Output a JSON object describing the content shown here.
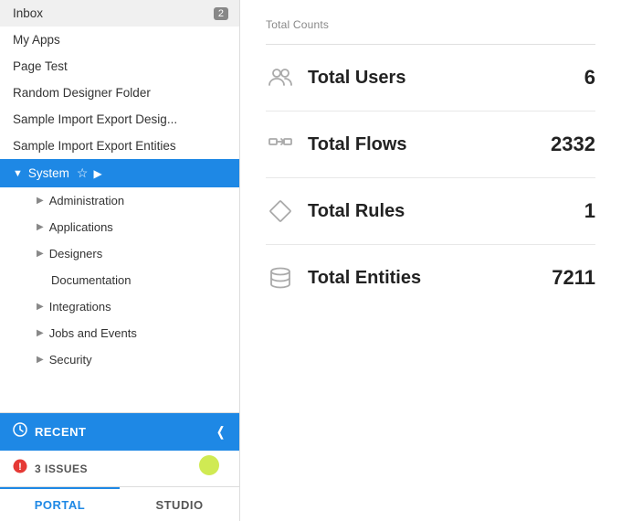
{
  "sidebar": {
    "nav_items": [
      {
        "id": "inbox",
        "label": "Inbox",
        "badge": "2",
        "indent": "root"
      },
      {
        "id": "my-apps",
        "label": "My Apps",
        "indent": "root"
      },
      {
        "id": "page-test",
        "label": "Page Test",
        "indent": "root"
      },
      {
        "id": "random-designer",
        "label": "Random Designer Folder",
        "indent": "root"
      },
      {
        "id": "sample-import-desig",
        "label": "Sample Import Export Desig...",
        "indent": "root"
      },
      {
        "id": "sample-import-entities",
        "label": "Sample Import Export Entities",
        "indent": "root"
      },
      {
        "id": "system",
        "label": "System",
        "indent": "root",
        "active": true
      }
    ],
    "sub_items": [
      {
        "id": "administration",
        "label": "Administration",
        "has_arrow": true
      },
      {
        "id": "applications",
        "label": "Applications",
        "has_arrow": true
      },
      {
        "id": "designers",
        "label": "Designers",
        "has_arrow": true
      },
      {
        "id": "documentation",
        "label": "Documentation",
        "has_arrow": false
      },
      {
        "id": "integrations",
        "label": "Integrations",
        "has_arrow": true
      },
      {
        "id": "jobs-and-events",
        "label": "Jobs and Events",
        "has_arrow": true
      },
      {
        "id": "security",
        "label": "Security",
        "has_arrow": true
      }
    ],
    "recent_label": "RECENT",
    "issues_label": "3 ISSUES",
    "tabs": [
      {
        "id": "portal",
        "label": "PORTAL"
      },
      {
        "id": "studio",
        "label": "STUDIO"
      }
    ],
    "active_tab": "portal"
  },
  "main": {
    "section_label": "Total Counts",
    "stats": [
      {
        "id": "total-users",
        "label": "Total Users",
        "value": "6",
        "icon": "users"
      },
      {
        "id": "total-flows",
        "label": "Total Flows",
        "value": "2332",
        "icon": "flows"
      },
      {
        "id": "total-rules",
        "label": "Total Rules",
        "value": "1",
        "icon": "rules"
      },
      {
        "id": "total-entities",
        "label": "Total Entities",
        "value": "7211",
        "icon": "entities"
      }
    ]
  }
}
